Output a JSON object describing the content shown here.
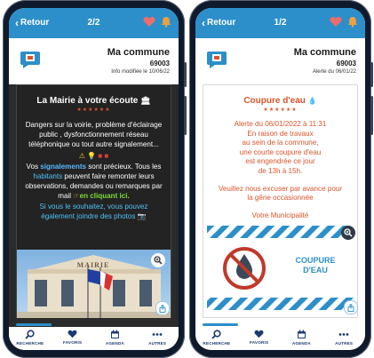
{
  "left": {
    "back_label": "Retour",
    "pager": "2/2",
    "commune": {
      "name": "Ma commune",
      "code": "69003",
      "info": "Info modifiée le 10/06/22"
    },
    "post": {
      "title": "La Mairie à votre écoute",
      "stars": "★★★★★★",
      "p1": "Dangers sur la voirie, problème d'éclairage public , dysfonctionnement réseau téléphonique ou tout autre signalement...",
      "p2_a": "Vos ",
      "p2_b": "signalements",
      "p2_c": " sont précieux. Tous les ",
      "p2_d": "habitants",
      "p2_e": " peuvent faire remonter leurs observations, demandes ou remarques par mail ",
      "p2_f": "en cliquant ici.",
      "p3": "Si vous le souhaitez, vous pouvez également joindre des photos",
      "photo_sign": "MAIRIE"
    }
  },
  "right": {
    "back_label": "Retour",
    "pager": "1/2",
    "commune": {
      "name": "Ma commune",
      "code": "69003",
      "info": "Alerte du 06/01/22"
    },
    "post": {
      "title": "Coupure d'eau",
      "stars": "★★★★★★",
      "p1": "Alerte du 06/01/2022 à 11:31\nEn raison de travaux\nau sein de la commune,\nune courte coupure d'eau\nest engendrée ce jour\nde 13h à 15h.",
      "p2": "Veuillez nous excuser par avance pour la gêne occasionnée",
      "p3": "Votre Municipalité",
      "banner_line1": "COUPURE",
      "banner_line2": "D'EAU"
    }
  },
  "tabs": [
    {
      "label": "RECHERCHE",
      "icon": "search-icon"
    },
    {
      "label": "FAVORIS",
      "icon": "heart-icon"
    },
    {
      "label": "AGENDA",
      "icon": "calendar-icon"
    },
    {
      "label": "AUTRES",
      "icon": "more-icon"
    }
  ],
  "colors": {
    "accent": "#2c8fc9",
    "alert": "#d9542b",
    "nav": "#1b3a72",
    "heart": "#f06b6b",
    "bell": "#f0a040"
  }
}
